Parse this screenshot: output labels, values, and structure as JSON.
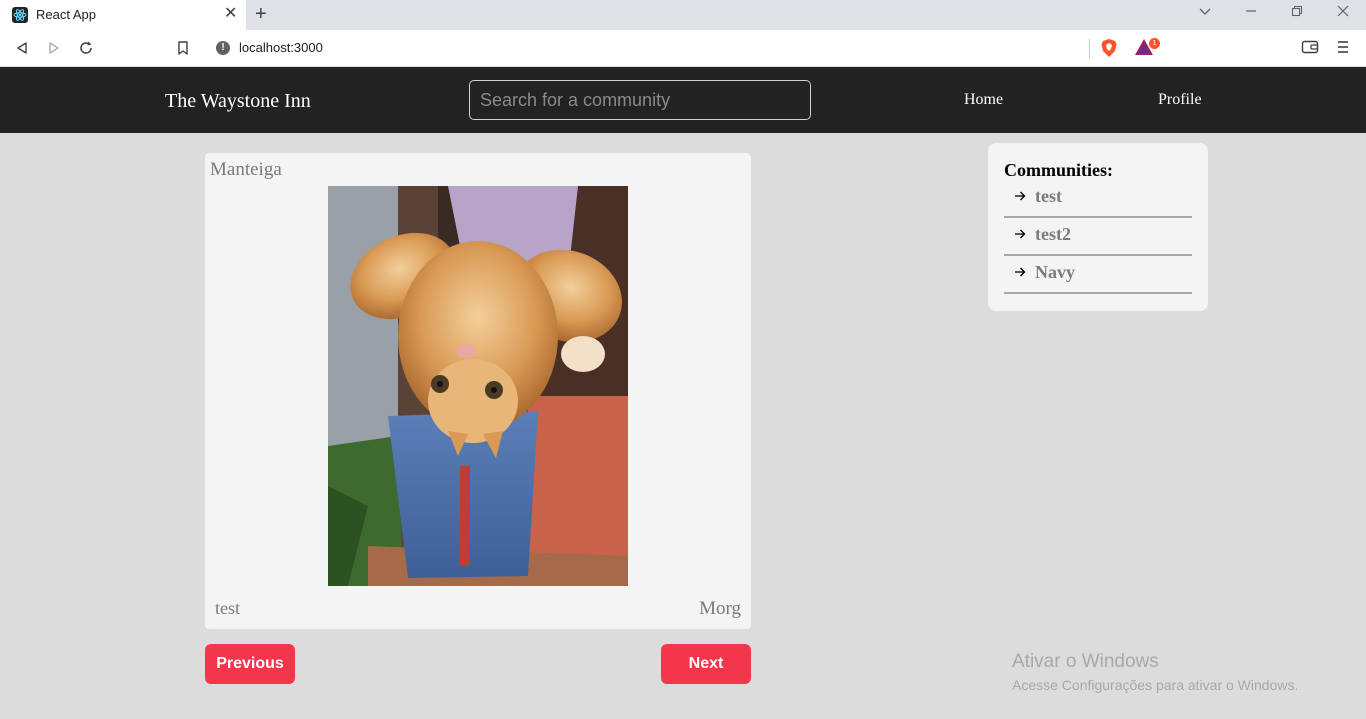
{
  "browser": {
    "tab_title": "React App",
    "tab_close": "✕",
    "new_tab": "+",
    "url": "localhost:3000",
    "bat_badge_count": "1",
    "icons": [
      "react-icon",
      "back-icon",
      "forward-icon",
      "reload-icon",
      "bookmark-icon",
      "info-icon",
      "brave-shield-icon",
      "brave-rewards-icon",
      "wallet-icon",
      "menu-icon"
    ]
  },
  "header": {
    "brand": "The Waystone Inn",
    "search_placeholder": "Search for a community",
    "nav": {
      "home": "Home",
      "profile": "Profile"
    }
  },
  "post": {
    "title": "Manteiga",
    "community": "test",
    "author": "Morg",
    "image_alt": "Orange kitten held upside down"
  },
  "pagination": {
    "previous": "Previous",
    "next": "Next"
  },
  "communities": {
    "heading": "Communities:",
    "items": [
      {
        "label": "test"
      },
      {
        "label": "test2"
      },
      {
        "label": "Navy"
      }
    ]
  },
  "watermark": {
    "title": "Ativar o Windows",
    "subtitle": "Acesse Configurações para ativar o Windows."
  },
  "colors": {
    "accent": "#f4364c",
    "header_bg": "#222222",
    "page_bg": "#dcdcdc",
    "card_bg": "#f4f4f4"
  }
}
